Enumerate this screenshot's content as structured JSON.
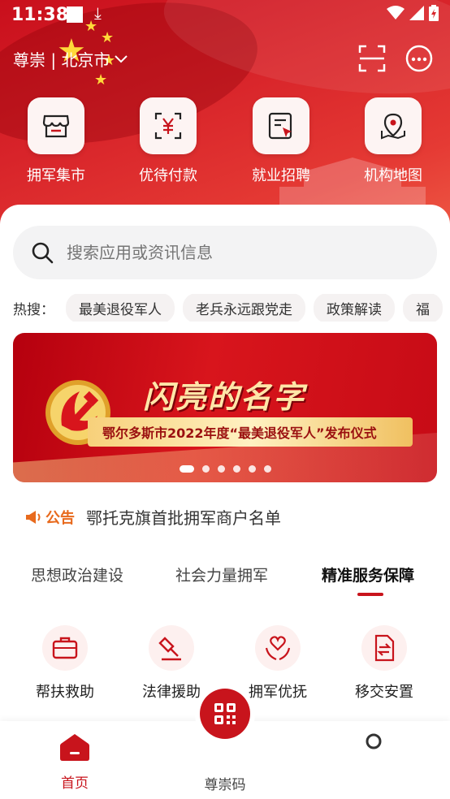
{
  "status_bar": {
    "time": "11:38"
  },
  "header": {
    "location": "尊崇 | 北京市",
    "quick_actions": [
      {
        "label": "拥军集市",
        "icon": "storefront-icon"
      },
      {
        "label": "优待付款",
        "icon": "yuan-scan-icon"
      },
      {
        "label": "就业招聘",
        "icon": "job-document-icon"
      },
      {
        "label": "机构地图",
        "icon": "map-pin-icon"
      }
    ]
  },
  "search": {
    "placeholder": "搜索应用或资讯信息"
  },
  "hot_search": {
    "label": "热搜：",
    "items": [
      "最美退役军人",
      "老兵永远跟党走",
      "政策解读",
      "福"
    ]
  },
  "banner": {
    "title": "闪亮的名字",
    "subtitle": "鄂尔多斯市2022年度“最美退役军人”发布仪式",
    "page_count": 6,
    "active_page": 1
  },
  "notice": {
    "tag": "公告",
    "text": "鄂托克旗首批拥军商户名单"
  },
  "tabs": [
    {
      "label": "思想政治建设",
      "active": false
    },
    {
      "label": "社会力量拥军",
      "active": false
    },
    {
      "label": "精准服务保障",
      "active": true
    }
  ],
  "services": [
    {
      "label": "帮扶救助",
      "icon": "briefcase-icon"
    },
    {
      "label": "法律援助",
      "icon": "gavel-icon"
    },
    {
      "label": "拥军优抚",
      "icon": "heart-hands-icon"
    },
    {
      "label": "移交安置",
      "icon": "transfer-document-icon"
    }
  ],
  "bottom_nav": {
    "home": "首页",
    "code": "尊崇码"
  },
  "colors": {
    "primary": "#c8141c",
    "notice": "#e86a1d"
  }
}
